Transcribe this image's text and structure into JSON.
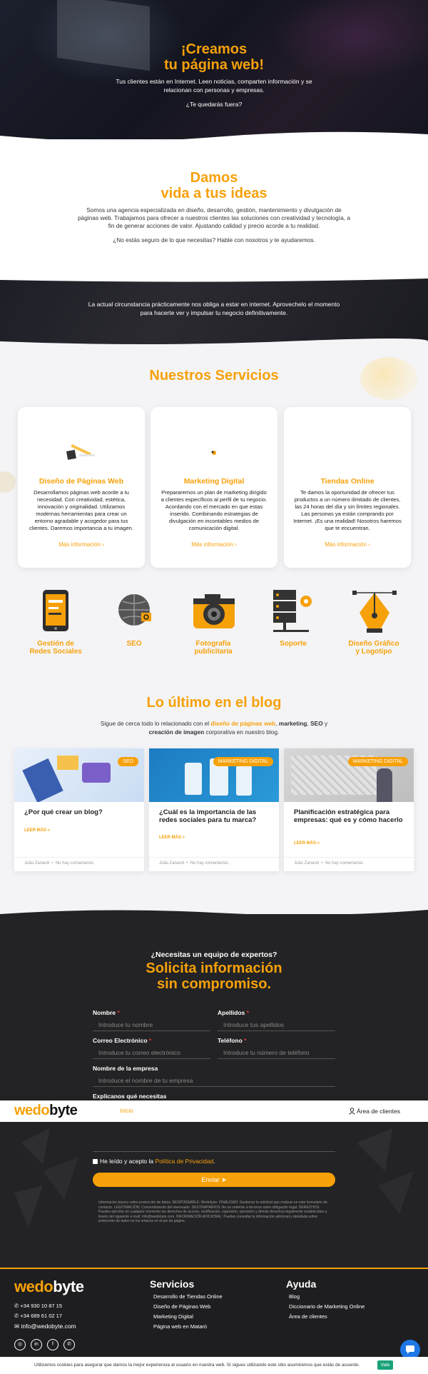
{
  "hero": {
    "title_line1": "¡Creamos",
    "title_line2": "tu página web!",
    "text_line1": "Tus clientes están en Internet. Leen noticias, comparten información y se",
    "text_line2": "relacionan con personas y empresas.",
    "question": "¿Te quedarás fuera?"
  },
  "ideas": {
    "title_line1": "Damos",
    "title_line2": "vida a tus ideas",
    "p1_line1": "Somos una agencia especializada en diseño, desarrollo, gestión, mantenimiento y divulgación de",
    "p1_line2": "páginas web. Trabajamos para ofrecer a nuestros clientes las soluciones con creatividad y tecnología, a",
    "p1_line3": "fin de generar acciones de valor. Ajustando calidad y precio acorde a tu realidad.",
    "p2": "¿No estás seguro de lo que necesitas? Hable con nosotros y te ayudaremos."
  },
  "circumstance": {
    "line1": "La actual circunstancia prácticamente nos obliga a estar en internet. Aprovechelo el momento",
    "line2": "para hacerte ver y impulsar tu negocio definitivamente."
  },
  "services": {
    "title": "Nuestros Servicios",
    "cards": [
      {
        "title": "Diseño de Páginas Web",
        "text": "Desarrollamos páginas web acorde a tu necesidad. Con creatividad, estética, innovación y originalidad. Utilizamos modernas herramientas para crear un entorno agradable y acogedor para tus clientes. Daremos importancia a tu imagen.",
        "link": "Más información ›"
      },
      {
        "title": "Marketing Digital",
        "text": "Prepararemos un plan de marketing dirigido a clientes específicos al perfil de tu negocio. Acordando con el mercado en que estas inserido. Combinando estrategias de divulgación en incontables medios de comunicación digital.",
        "link": "Más información ›"
      },
      {
        "title": "Tiendas Online",
        "text": "Te damos la oportunidad de ofrecer tus productos a un número ilimitado de clientes, las 24 horas del día y sin límites regionales. Las personas ya están comprando por Internet. ¡Es una realidad! Nosotros haremos que te encuentran.",
        "link": "Más información ›"
      }
    ],
    "icons": [
      {
        "label_line1": "Gestión de",
        "label_line2": "Redes Sociales"
      },
      {
        "label_line1": "SEO",
        "label_line2": ""
      },
      {
        "label_line1": "Fotografía",
        "label_line2": "publicitaria"
      },
      {
        "label_line1": "Soporte",
        "label_line2": ""
      },
      {
        "label_line1": "Diseño Gráfico",
        "label_line2": "y Logotipo"
      }
    ]
  },
  "blog": {
    "title": "Lo último en el blog",
    "sub_a": "Sigue de cerca todo lo relacionado con el ",
    "sub_b": "diseño de páginas web",
    "sub_c": ", ",
    "sub_d": "marketing",
    "sub_e": ", ",
    "sub_f": "SEO",
    "sub_g": " y",
    "sub_h": "creación de imagen",
    "sub_i": " corporativa en nuestro blog.",
    "posts": [
      {
        "badge": "SEO",
        "title": "¿Por qué crear un blog?",
        "more": "LEER MÁS »",
        "author": "João Zanardi",
        "comments": "No hay comentarios"
      },
      {
        "badge": "MARKETING DIGITAL",
        "title": "¿Cuál es la importancia de las redes sociales para tu marca?",
        "more": "LEER MÁS »",
        "author": "João Zanardi",
        "comments": "No hay comentarios"
      },
      {
        "badge": "MARKETING DIGITAL",
        "title": "Planificación estratégica para empresas: qué es y cómo hacerlo",
        "more": "LEER MÁS »",
        "author": "João Zanardi",
        "comments": "No hay comentarios"
      }
    ]
  },
  "form": {
    "question": "¿Necesitas un equipo de expertos?",
    "title_line1": "Solicita información",
    "title_line2": "sin compromiso.",
    "nombre_label": "Nombre",
    "nombre_placeholder": "Introduce tu nombre",
    "apellidos_label": "Apellidos",
    "apellidos_placeholder": "Introduce tus apellidos",
    "correo_label": "Correo Electrónico",
    "correo_placeholder": "Introduce tu correo electrónico",
    "telefono_label": "Teléfono",
    "telefono_placeholder": "Introduce tu número de teléfono",
    "empresa_label": "Nombre de la empresa",
    "empresa_placeholder": "Introduce el nombre de tu empresa",
    "explica_label": "Explicanos qué necesitas",
    "req": "*",
    "privacy_a": "He leído y acepto la ",
    "privacy_b": "Política de Privacidad",
    "privacy_c": ".",
    "send": "Enviar ➤",
    "legal": "Información básica sobre protección de datos: RESPONSABLE: Wedobyte. FINALIDAD: Gestionar la solicitud que realizas en este formulario de contacto. LEGITIMACIÓN: Consentimiento del interesado. DESTINATARIOS: No se cederán a terceros salvo obligación legal. DERECHOS: Puedes ejercitar en cualquier momento tus derechos de acceso, rectificación, supresión, oposición y demás derechos legalmente establecidos a través del siguiente e-mail: info@wedobyte.com. INFORMACIÓN ADICIONAL: Puedes consultar la información adicional y detallada sobre protección de datos en los enlaces en el pie de página."
  },
  "topbar": {
    "logo_a": "wedo",
    "logo_b": "byte",
    "nav_item": "Inicio",
    "client_area": "Área de clientes"
  },
  "footer": {
    "logo_a": "wedo",
    "logo_b": "byte",
    "phone1": "+34 930 10 87 15",
    "phone2": "+34 689 61 02 17",
    "email": "info@wedobyte.com",
    "servicios_title": "Servicios",
    "servicios": [
      "Desarrollo de Tiendas Online",
      "Diseño de Páginas Web",
      "Marketing Digital",
      "Página web en Mataró"
    ],
    "ayuda_title": "Ayuda",
    "ayuda": [
      "Blog",
      "Diccionario de Marketing Online",
      "Área de clientes"
    ]
  },
  "cookie": {
    "text": "Utilizamos cookies para asegurar que damos la mejor experiencia al usuario en nuestra web. Si sigues utilizando este sitio asumiremos que estás de acuerdo.",
    "button": "Vale"
  },
  "colors": {
    "accent": "#f6a10a",
    "dark": "#232325",
    "chat": "#1e78e6"
  }
}
